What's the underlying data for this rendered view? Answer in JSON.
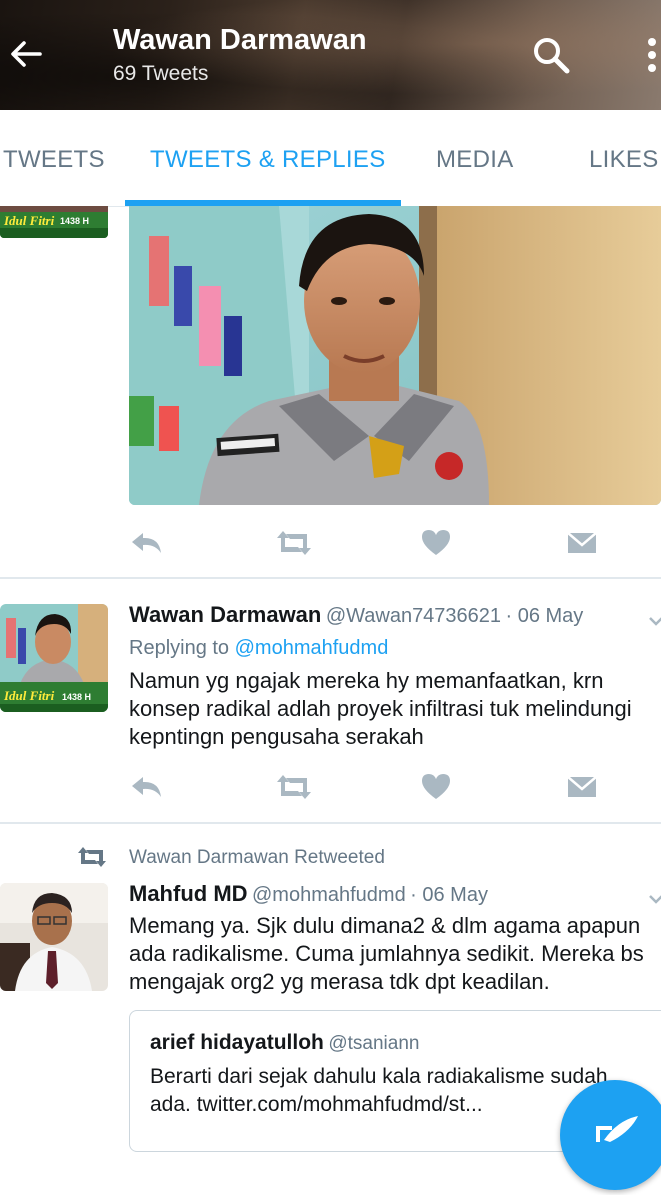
{
  "header": {
    "title": "Wawan Darmawan",
    "subtitle": "69 Tweets",
    "icons": [
      "back-arrow-icon",
      "search-icon",
      "more-vertical-icon"
    ]
  },
  "tabs": [
    {
      "label": "TWEETS",
      "active": false
    },
    {
      "label": "TWEETS & REPLIES",
      "active": true
    },
    {
      "label": "MEDIA",
      "active": false
    },
    {
      "label": "LIKES",
      "active": false
    }
  ],
  "colors": {
    "accent": "#1da1f2",
    "muted": "#657786",
    "icon": "#aab8c2",
    "divider": "#e1e8ed"
  },
  "avatar_badge": {
    "text": "Idul Fitri",
    "year": "1438 H"
  },
  "tweets": [
    {
      "name": "Wawan Darmawan",
      "handle": "@Wawan74736621",
      "date": "· 06 May",
      "reply_prefix": "Replying to",
      "reply_to": "@mohmahfudmd",
      "text": "Namun yg ngajak mereka hy memanfaatkan, krn konsep radikal adlah proyek infiltrasi tuk melindungi kepntingn pengusaha serakah"
    },
    {
      "retweet_label": "Wawan Darmawan Retweeted",
      "name": "Mahfud MD",
      "handle": "@mohmahfudmd",
      "date": "· 06 May",
      "text": "Memang ya. Sjk dulu dimana2 & dlm agama apapun ada radikalisme. Cuma jumlahnya sedikit. Mereka bs mengajak org2 yg merasa tdk dpt keadilan.",
      "quote": {
        "name": "arief hidayatulloh",
        "handle": "@tsaniann",
        "text": "Berarti dari sejak dahulu kala radiakalisme sudah ada. twitter.com/mohmahfudmd/st..."
      }
    }
  ]
}
